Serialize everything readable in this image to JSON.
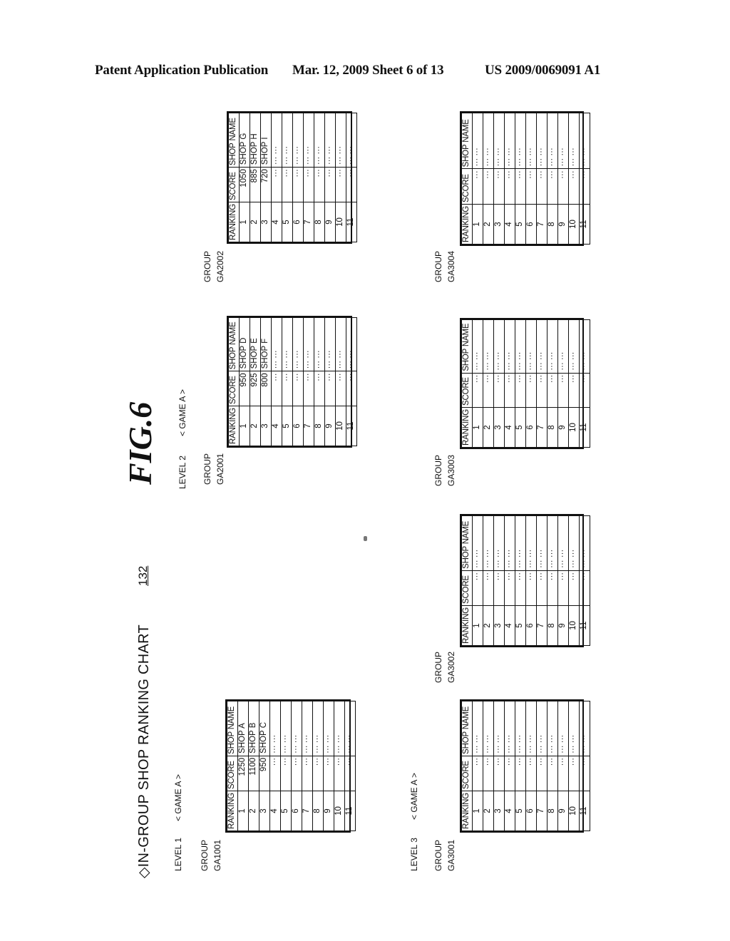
{
  "header": {
    "left": "Patent Application Publication",
    "middle": "Mar. 12, 2009  Sheet 6 of 13",
    "right": "US 2009/0069091 A1"
  },
  "figure": {
    "label": "FIG.6",
    "title": "◇IN-GROUP SHOP RANKING CHART",
    "reference_numeral": "132"
  },
  "columns": [
    "RANKING",
    "SCORE",
    "SHOP NAME"
  ],
  "levels": [
    {
      "level_label": "LEVEL 1",
      "game_label": "< GAME A >",
      "groups": [
        {
          "group_label": "GROUP",
          "group_id": "GA1001",
          "rows": [
            {
              "rank": "1",
              "score": "1250",
              "name": "SHOP A"
            },
            {
              "rank": "2",
              "score": "1100",
              "name": "SHOP B"
            },
            {
              "rank": "3",
              "score": "950",
              "name": "SHOP C"
            },
            {
              "rank": "4",
              "score": "···",
              "name": "···  ···"
            },
            {
              "rank": "5",
              "score": "···",
              "name": "···  ···"
            },
            {
              "rank": "6",
              "score": "···",
              "name": "···  ···"
            },
            {
              "rank": "7",
              "score": "···",
              "name": "···  ···"
            },
            {
              "rank": "8",
              "score": "···",
              "name": "···  ···"
            },
            {
              "rank": "9",
              "score": "···",
              "name": "···  ···"
            },
            {
              "rank": "10",
              "score": "···",
              "name": "···  ···"
            },
            {
              "rank": "11",
              "score": "···",
              "name": "···  ···"
            }
          ]
        }
      ]
    },
    {
      "level_label": "LEVEL 2",
      "game_label": "< GAME A >",
      "groups": [
        {
          "group_label": "GROUP",
          "group_id": "GA2001",
          "rows": [
            {
              "rank": "1",
              "score": "950",
              "name": "SHOP D"
            },
            {
              "rank": "2",
              "score": "925",
              "name": "SHOP E"
            },
            {
              "rank": "3",
              "score": "800",
              "name": "SHOP F"
            },
            {
              "rank": "4",
              "score": "···",
              "name": "···  ···"
            },
            {
              "rank": "5",
              "score": "···",
              "name": "···  ···"
            },
            {
              "rank": "6",
              "score": "···",
              "name": "···  ···"
            },
            {
              "rank": "7",
              "score": "···",
              "name": "···  ···"
            },
            {
              "rank": "8",
              "score": "···",
              "name": "···  ···"
            },
            {
              "rank": "9",
              "score": "···",
              "name": "···  ···"
            },
            {
              "rank": "10",
              "score": "···",
              "name": "···  ···"
            },
            {
              "rank": "11",
              "score": "···",
              "name": "···  ···"
            }
          ]
        },
        {
          "group_label": "GROUP",
          "group_id": "GA2002",
          "rows": [
            {
              "rank": "1",
              "score": "1050",
              "name": "SHOP G"
            },
            {
              "rank": "2",
              "score": "885",
              "name": "SHOP H"
            },
            {
              "rank": "3",
              "score": "720",
              "name": "SHOP I"
            },
            {
              "rank": "4",
              "score": "···",
              "name": "···  ···"
            },
            {
              "rank": "5",
              "score": "···",
              "name": "···  ···"
            },
            {
              "rank": "6",
              "score": "···",
              "name": "···  ···"
            },
            {
              "rank": "7",
              "score": "···",
              "name": "···  ···"
            },
            {
              "rank": "8",
              "score": "···",
              "name": "···  ···"
            },
            {
              "rank": "9",
              "score": "···",
              "name": "···  ···"
            },
            {
              "rank": "10",
              "score": "···",
              "name": "···  ···"
            },
            {
              "rank": "11",
              "score": "···",
              "name": "···  ···"
            }
          ]
        }
      ]
    },
    {
      "level_label": "LEVEL 3",
      "game_label": "< GAME A >",
      "groups": [
        {
          "group_label": "GROUP",
          "group_id": "GA3001",
          "rows": [
            {
              "rank": "1",
              "score": "···",
              "name": "···  ···"
            },
            {
              "rank": "2",
              "score": "···",
              "name": "···  ···"
            },
            {
              "rank": "3",
              "score": "···",
              "name": "···  ···"
            },
            {
              "rank": "4",
              "score": "···",
              "name": "···  ···"
            },
            {
              "rank": "5",
              "score": "···",
              "name": "···  ···"
            },
            {
              "rank": "6",
              "score": "···",
              "name": "···  ···"
            },
            {
              "rank": "7",
              "score": "···",
              "name": "···  ···"
            },
            {
              "rank": "8",
              "score": "···",
              "name": "···  ···"
            },
            {
              "rank": "9",
              "score": "···",
              "name": "···  ···"
            },
            {
              "rank": "10",
              "score": "···",
              "name": "···  ···"
            },
            {
              "rank": "11",
              "score": "···",
              "name": "···  ···"
            }
          ]
        },
        {
          "group_label": "GROUP",
          "group_id": "GA3002",
          "rows": [
            {
              "rank": "1",
              "score": "···",
              "name": "···  ···"
            },
            {
              "rank": "2",
              "score": "···",
              "name": "···  ···"
            },
            {
              "rank": "3",
              "score": "···",
              "name": "···  ···"
            },
            {
              "rank": "4",
              "score": "···",
              "name": "···  ···"
            },
            {
              "rank": "5",
              "score": "···",
              "name": "···  ···"
            },
            {
              "rank": "6",
              "score": "···",
              "name": "···  ···"
            },
            {
              "rank": "7",
              "score": "···",
              "name": "···  ···"
            },
            {
              "rank": "8",
              "score": "···",
              "name": "···  ···"
            },
            {
              "rank": "9",
              "score": "···",
              "name": "···  ···"
            },
            {
              "rank": "10",
              "score": "···",
              "name": "···  ···"
            },
            {
              "rank": "11",
              "score": "···",
              "name": "···  ···"
            }
          ]
        },
        {
          "group_label": "GROUP",
          "group_id": "GA3003",
          "rows": [
            {
              "rank": "1",
              "score": "···",
              "name": "···  ···"
            },
            {
              "rank": "2",
              "score": "···",
              "name": "···  ···"
            },
            {
              "rank": "3",
              "score": "···",
              "name": "···  ···"
            },
            {
              "rank": "4",
              "score": "···",
              "name": "···  ···"
            },
            {
              "rank": "5",
              "score": "···",
              "name": "···  ···"
            },
            {
              "rank": "6",
              "score": "···",
              "name": "···  ···"
            },
            {
              "rank": "7",
              "score": "···",
              "name": "···  ···"
            },
            {
              "rank": "8",
              "score": "···",
              "name": "···  ···"
            },
            {
              "rank": "9",
              "score": "···",
              "name": "···  ···"
            },
            {
              "rank": "10",
              "score": "···",
              "name": "···  ···"
            },
            {
              "rank": "11",
              "score": "···",
              "name": "···  ···"
            }
          ]
        },
        {
          "group_label": "GROUP",
          "group_id": "GA3004",
          "rows": [
            {
              "rank": "1",
              "score": "···",
              "name": "···  ···"
            },
            {
              "rank": "2",
              "score": "···",
              "name": "···  ···"
            },
            {
              "rank": "3",
              "score": "···",
              "name": "···  ···"
            },
            {
              "rank": "4",
              "score": "···",
              "name": "···  ···"
            },
            {
              "rank": "5",
              "score": "···",
              "name": "···  ···"
            },
            {
              "rank": "6",
              "score": "···",
              "name": "···  ···"
            },
            {
              "rank": "7",
              "score": "···",
              "name": "···  ···"
            },
            {
              "rank": "8",
              "score": "···",
              "name": "···  ···"
            },
            {
              "rank": "9",
              "score": "···",
              "name": "···  ···"
            },
            {
              "rank": "10",
              "score": "···",
              "name": "···  ···"
            },
            {
              "rank": "11",
              "score": "···",
              "name": "···  ···"
            }
          ]
        }
      ]
    }
  ]
}
